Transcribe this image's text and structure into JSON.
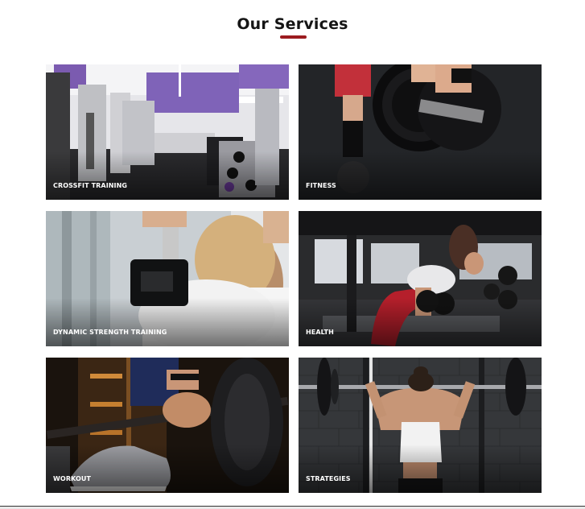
{
  "section": {
    "title": "Our Services",
    "accent_color": "#9b1b1f"
  },
  "services": [
    {
      "label": "CROSSFIT TRAINING"
    },
    {
      "label": "FITNESS"
    },
    {
      "label": "DYNAMIC STRENGTH TRAINING"
    },
    {
      "label": "HEALTH"
    },
    {
      "label": "WORKOUT"
    },
    {
      "label": "STRATEGIES"
    }
  ]
}
